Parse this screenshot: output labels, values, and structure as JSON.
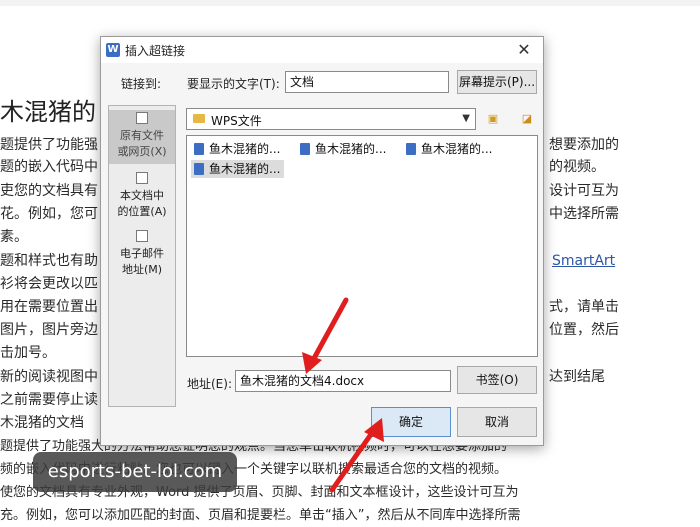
{
  "document": {
    "heading": "木混猪的",
    "lines_left": [
      "题提供了功能强",
      "题的嵌入代码中",
      "吏您的文档具有",
      "花。例如，您可",
      "素。",
      "题和样式也有助",
      "衫将会更改以匹",
      "用在需要位置出",
      "图片，图片旁边",
      "击加号。",
      "新的阅读视图中",
      "之前需要停止读",
      "木混猪的文档"
    ],
    "lines_right": [
      "想要添加的",
      "的视频。",
      "设计可互为",
      "中选择所需",
      "SmartArt",
      "式，请单击",
      "位置，然后",
      "达到结尾"
    ],
    "bottom_lines": [
      "题提供了功能强大的方法帮助您证明您的观点。当您单击联机视频时，可以在想要添加的",
      "频的嵌入代码中进行粘贴。您也可以键入一个关键字以联机搜索最适合您的文档的视频。",
      "使您的文档具有专业外观，Word 提供了页眉、页脚、封面和文本框设计，这些设计可互为",
      "充。例如，您可以添加匹配的封面、页眉和提要栏。单击“插入”，然后从不同库中选择所需"
    ]
  },
  "dialog": {
    "title": "插入超链接",
    "close_glyph": "✕",
    "link_to_label": "链接到:",
    "display_text_label": "要显示的文字(T):",
    "display_text_value": "文档",
    "screen_tip_button": "屏幕提示(P)...",
    "left_panel": [
      {
        "label": "原有文件\n或网页(X)",
        "selected": true
      },
      {
        "label": "本文档中\n的位置(A)",
        "selected": false
      },
      {
        "label": "电子邮件\n地址(M)",
        "selected": false
      }
    ],
    "folder": "WPS文件",
    "files": [
      {
        "name": "鱼木混猪的...",
        "selected": false
      },
      {
        "name": "鱼木混猪的...",
        "selected": false
      },
      {
        "name": "鱼木混猪的...",
        "selected": false
      },
      {
        "name": "鱼木混猪的...",
        "selected": true
      }
    ],
    "address_label": "地址(E):",
    "address_value": "鱼木混猪的文档4.docx",
    "bookmark_button": "书签(O)",
    "ok_button": "确定",
    "cancel_button": "取消"
  },
  "watermark": "esports-bet-lol.com",
  "colors": {
    "arrow": "#e01e1e",
    "accent": "#3c6fc4"
  }
}
